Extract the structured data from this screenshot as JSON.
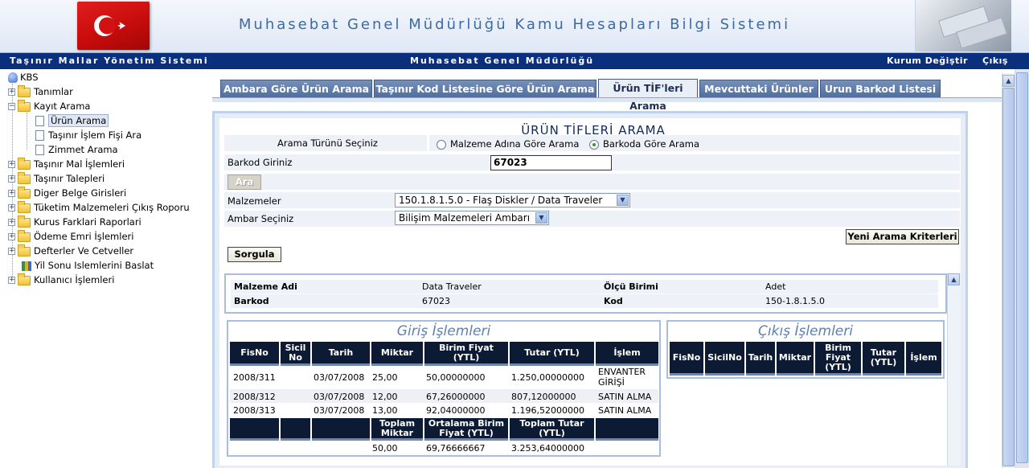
{
  "header": {
    "title": "Muhasebat Genel Müdürlüğü Kamu Hesapları Bilgi Sistemi",
    "flag_icon": "turkish-flag-icon"
  },
  "navbar": {
    "left": "Taşınır Mallar Yönetim Sistemi",
    "center": "Muhasebat Genel Müdürlüğü",
    "kurum": "Kurum Değiştir",
    "cikis": "Çıkış"
  },
  "tree": {
    "root": "KBS",
    "items": [
      {
        "label": "Tanımlar"
      },
      {
        "label": "Kayıt Arama"
      },
      {
        "label": "Ürün Arama"
      },
      {
        "label": "Taşınır İşlem Fişi Ara"
      },
      {
        "label": "Zimmet Arama"
      },
      {
        "label": "Taşınır Mal İşlemleri"
      },
      {
        "label": "Taşınır Talepleri"
      },
      {
        "label": "Diger Belge Girisleri"
      },
      {
        "label": "Tüketim Malzemeleri Çıkış Roporu"
      },
      {
        "label": "Kurus Farklari Raporlari"
      },
      {
        "label": "Ödeme Emri İşlemleri"
      },
      {
        "label": "Defterler Ve Cetveller"
      },
      {
        "label": "Yil Sonu Islemlerini Baslat"
      },
      {
        "label": "Kullanıcı İşlemleri"
      }
    ]
  },
  "tabs": [
    {
      "label": "Ambara Göre Ürün Arama"
    },
    {
      "label": "Taşınır Kod Listesine Göre Ürün Arama"
    },
    {
      "label": "Ürün TİF'leri Arama"
    },
    {
      "label": "Mevcuttaki Ürünler"
    },
    {
      "label": "Urun Barkod Listesi"
    }
  ],
  "form": {
    "title": "ÜRÜN TİFLERİ ARAMA",
    "search_type_label": "Arama Türünü Seçiniz",
    "radio1": "Malzeme Adına Göre Arama",
    "radio2": "Barkoda Göre Arama",
    "barcode_label": "Barkod Giriniz",
    "barcode_value": "67023",
    "ara_button": "Ara",
    "malzemeler_label": "Malzemeler",
    "malzemeler_value": "150.1.8.1.5.0 - Flaş Diskler / Data Traveler",
    "ambar_label": "Ambar Seçiniz",
    "ambar_value": "Bilişim Malzemeleri Ambarı",
    "yeni_button": "Yeni Arama Kriterleri",
    "sorgula_button": "Sorgula"
  },
  "detail": {
    "malzeme_adi_label": "Malzeme Adi",
    "malzeme_adi": "Data Traveler",
    "olcu_label": "Ölçü Birimi",
    "olcu": "Adet",
    "barkod_label": "Barkod",
    "barkod": "67023",
    "kod_label": "Kod",
    "kod": "150-1.8.1.5.0"
  },
  "giris": {
    "title": "Giriş İşlemleri",
    "headers": [
      "FisNo",
      "Sicil No",
      "Tarih",
      "Miktar",
      "Birim Fiyat (YTL)",
      "Tutar (YTL)",
      "İşlem"
    ],
    "rows": [
      [
        "2008/311",
        "",
        "03/07/2008",
        "25,00",
        "50,00000000",
        "1.250,00000000",
        "ENVANTER GİRİŞİ"
      ],
      [
        "2008/312",
        "",
        "03/07/2008",
        "12,00",
        "67,26000000",
        "807,12000000",
        "SATIN ALMA"
      ],
      [
        "2008/313",
        "",
        "03/07/2008",
        "13,00",
        "92,04000000",
        "1.196,52000000",
        "SATIN ALMA"
      ]
    ],
    "total_headers": [
      "Toplam Miktar",
      "Ortalama Birim Fiyat (YTL)",
      "Toplam Tutar (YTL)"
    ],
    "totals": [
      "50,00",
      "69,76666667",
      "3.253,64000000"
    ]
  },
  "cikis": {
    "title": "Çıkış İşlemleri",
    "headers": [
      "FisNo",
      "SicilNo",
      "Tarih",
      "Miktar",
      "Birim Fiyat (YTL)",
      "Tutar (YTL)",
      "İşlem"
    ]
  }
}
